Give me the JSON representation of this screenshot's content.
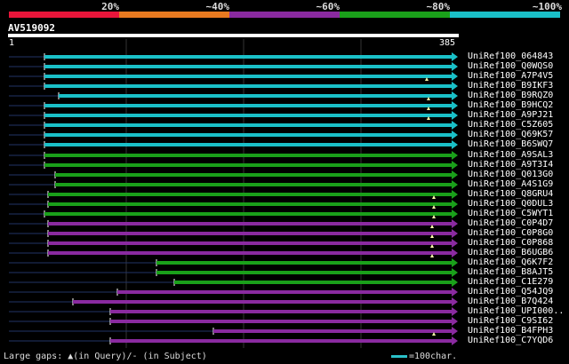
{
  "legend": [
    {
      "label": "20%",
      "color": "#e8153a"
    },
    {
      "label": "~40%",
      "color": "#e87a20"
    },
    {
      "label": "~60%",
      "color": "#8a2aa0"
    },
    {
      "label": "~80%",
      "color": "#1aa01a"
    },
    {
      "label": "~100%",
      "color": "#1ac0c8"
    }
  ],
  "query": {
    "title": "AV519092",
    "start": "1",
    "end": "385"
  },
  "hits": [
    {
      "name": "UniRef100_064843",
      "color": "#1ac0c8",
      "start": 50,
      "gap": null
    },
    {
      "name": "UniRef100_Q0WQS0",
      "color": "#1ac0c8",
      "start": 50,
      "gap": null
    },
    {
      "name": "UniRef100_A7P4V5",
      "color": "#1ac0c8",
      "start": 50,
      "gap": 480
    },
    {
      "name": "UniRef100_B9IKF3",
      "color": "#1ac0c8",
      "start": 50,
      "gap": null
    },
    {
      "name": "UniRef100_B9RQZ0",
      "color": "#1ac0c8",
      "start": 66,
      "gap": 482
    },
    {
      "name": "UniRef100_B9HCQ2",
      "color": "#1ac0c8",
      "start": 50,
      "gap": 482
    },
    {
      "name": "UniRef100_A9PJ21",
      "color": "#1ac0c8",
      "start": 50,
      "gap": 482
    },
    {
      "name": "UniRef100_C5Z605",
      "color": "#1ac0c8",
      "start": 50,
      "gap": null
    },
    {
      "name": "UniRef100_Q69K57",
      "color": "#1ac0c8",
      "start": 50,
      "gap": null
    },
    {
      "name": "UniRef100_B6SWQ7",
      "color": "#1ac0c8",
      "start": 50,
      "gap": null
    },
    {
      "name": "UniRef100_A9SAL3",
      "color": "#1aa01a",
      "start": 50,
      "gap": null
    },
    {
      "name": "UniRef100_A9T3I4",
      "color": "#1aa01a",
      "start": 50,
      "gap": null
    },
    {
      "name": "UniRef100_Q013G0",
      "color": "#1aa01a",
      "start": 62,
      "gap": null
    },
    {
      "name": "UniRef100_A4S1G9",
      "color": "#1aa01a",
      "start": 62,
      "gap": null
    },
    {
      "name": "UniRef100_Q8GRU4",
      "color": "#1aa01a",
      "start": 54,
      "gap": 488
    },
    {
      "name": "UniRef100_Q0DUL3",
      "color": "#1aa01a",
      "start": 54,
      "gap": 488
    },
    {
      "name": "UniRef100_C5WYT1",
      "color": "#1aa01a",
      "start": 50,
      "gap": 488
    },
    {
      "name": "UniRef100_C0P4D7",
      "color": "#8a2aa0",
      "start": 54,
      "gap": 486
    },
    {
      "name": "UniRef100_C0P8G0",
      "color": "#8a2aa0",
      "start": 54,
      "gap": 486
    },
    {
      "name": "UniRef100_C0P868",
      "color": "#8a2aa0",
      "start": 54,
      "gap": 486
    },
    {
      "name": "UniRef100_B6UGB6",
      "color": "#8a2aa0",
      "start": 54,
      "gap": 486
    },
    {
      "name": "UniRef100_Q6K7F2",
      "color": "#1aa01a",
      "start": 176,
      "gap": null
    },
    {
      "name": "UniRef100_B8AJT5",
      "color": "#1aa01a",
      "start": 176,
      "gap": null
    },
    {
      "name": "UniRef100_C1E279",
      "color": "#1aa01a",
      "start": 196,
      "gap": null
    },
    {
      "name": "UniRef100_Q54JQ9",
      "color": "#8a2aa0",
      "start": 132,
      "gap": null
    },
    {
      "name": "UniRef100_B7Q424",
      "color": "#8a2aa0",
      "start": 82,
      "gap": null
    },
    {
      "name": "UniRef100_UPI000..",
      "color": "#8a2aa0",
      "start": 124,
      "gap": null
    },
    {
      "name": "UniRef100_C9SI62",
      "color": "#8a2aa0",
      "start": 124,
      "gap": null
    },
    {
      "name": "UniRef100_B4FPH3",
      "color": "#8a2aa0",
      "start": 240,
      "gap": 488
    },
    {
      "name": "UniRef100_C7YQD6",
      "color": "#8a2aa0",
      "start": 124,
      "gap": null
    }
  ],
  "footer": {
    "gaps_text": "Large gaps: ▲(in Query)/- (in Subject)",
    "scale_text": "=100char."
  }
}
